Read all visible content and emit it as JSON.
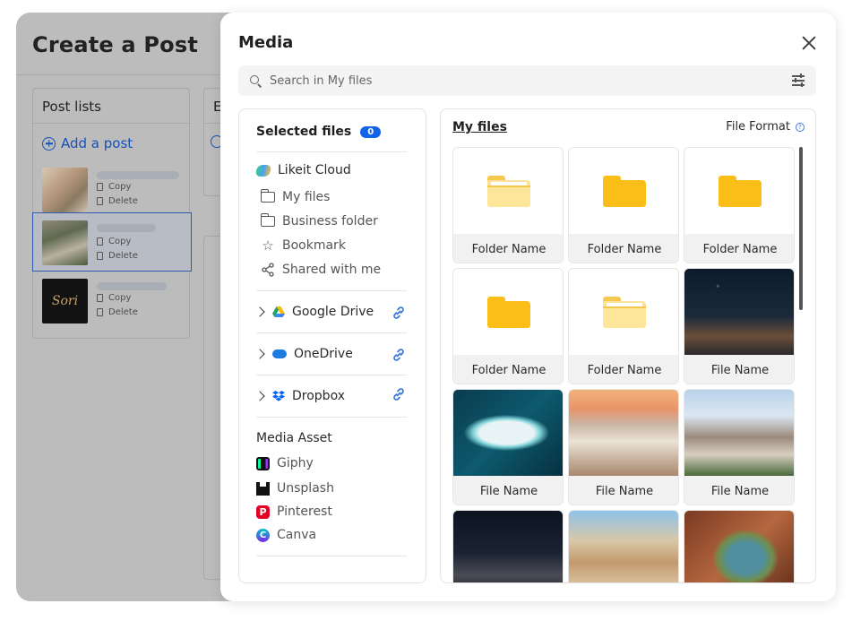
{
  "background": {
    "page_title": "Create a Post",
    "post_lists": {
      "title": "Post lists",
      "add_label": "Add a post",
      "posts": [
        {
          "copy_label": "Copy",
          "delete_label": "Delete"
        },
        {
          "copy_label": "Copy",
          "delete_label": "Delete"
        },
        {
          "copy_label": "Copy",
          "delete_label": "Delete",
          "thumb_text": "Sori"
        }
      ]
    },
    "second_column_title": "E"
  },
  "modal": {
    "title": "Media",
    "search": {
      "placeholder": "Search in My files",
      "icon": "search-icon",
      "filter_icon": "sliders-icon"
    },
    "left_panel": {
      "selected_files_label": "Selected files",
      "selected_count": "0",
      "likeit_cloud": {
        "label": "Likeit Cloud",
        "items": [
          {
            "label": "My files",
            "icon": "folder-icon"
          },
          {
            "label": "Business folder",
            "icon": "open-folder-icon"
          },
          {
            "label": "Bookmark",
            "icon": "star-icon"
          },
          {
            "label": "Shared with me",
            "icon": "share-icon"
          }
        ]
      },
      "providers": [
        {
          "label": "Google Drive",
          "icon": "google-drive-icon"
        },
        {
          "label": "OneDrive",
          "icon": "onedrive-icon"
        },
        {
          "label": "Dropbox",
          "icon": "dropbox-icon"
        }
      ],
      "media_asset": {
        "title": "Media Asset",
        "items": [
          {
            "label": "Giphy",
            "icon": "giphy-icon"
          },
          {
            "label": "Unsplash",
            "icon": "unsplash-icon"
          },
          {
            "label": "Pinterest",
            "icon": "pinterest-icon"
          },
          {
            "label": "Canva",
            "icon": "canva-icon"
          }
        ]
      }
    },
    "right_panel": {
      "breadcrumb": "My files",
      "file_format_label": "File Format",
      "tiles": [
        {
          "caption": "Folder Name",
          "kind": "folder-open"
        },
        {
          "caption": "Folder Name",
          "kind": "folder"
        },
        {
          "caption": "Folder Name",
          "kind": "folder"
        },
        {
          "caption": "Folder Name",
          "kind": "folder"
        },
        {
          "caption": "Folder Name",
          "kind": "folder-open"
        },
        {
          "caption": "File Name",
          "kind": "image"
        },
        {
          "caption": "File Name",
          "kind": "image"
        },
        {
          "caption": "File Name",
          "kind": "image"
        },
        {
          "caption": "File Name",
          "kind": "image"
        },
        {
          "caption": "",
          "kind": "image"
        },
        {
          "caption": "",
          "kind": "image"
        },
        {
          "caption": "",
          "kind": "image"
        }
      ]
    }
  },
  "colors": {
    "accent": "#1462e8",
    "folder_yellow": "#fbbd17",
    "overlay_gray": "#bcbcbc"
  }
}
